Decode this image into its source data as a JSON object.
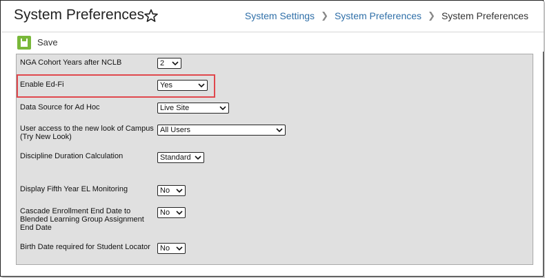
{
  "header": {
    "title": "System Preferences",
    "breadcrumb": [
      "System Settings",
      "System Preferences",
      "System Preferences"
    ]
  },
  "toolbar": {
    "save_label": "Save"
  },
  "preferences": [
    {
      "label": "NGA Cohort Years after NCLB",
      "value": "2"
    },
    {
      "label": "Enable Ed-Fi",
      "value": "Yes"
    },
    {
      "label": "Data Source for Ad Hoc",
      "value": "Live Site"
    },
    {
      "label": "User access to the new look of Campus (Try New Look)",
      "value": "All Users"
    },
    {
      "label": "Discipline Duration Calculation",
      "value": "Standard"
    },
    {
      "label": "Display Fifth Year EL Monitoring",
      "value": "No"
    },
    {
      "label": "Cascade Enrollment End Date to Blended Learning Group Assignment End Date",
      "value": "No"
    },
    {
      "label": "Birth Date required for Student Locator",
      "value": "No"
    }
  ],
  "colors": {
    "highlight": "#e0474c",
    "save_icon": "#79b83a",
    "link": "#2f6fa8"
  }
}
